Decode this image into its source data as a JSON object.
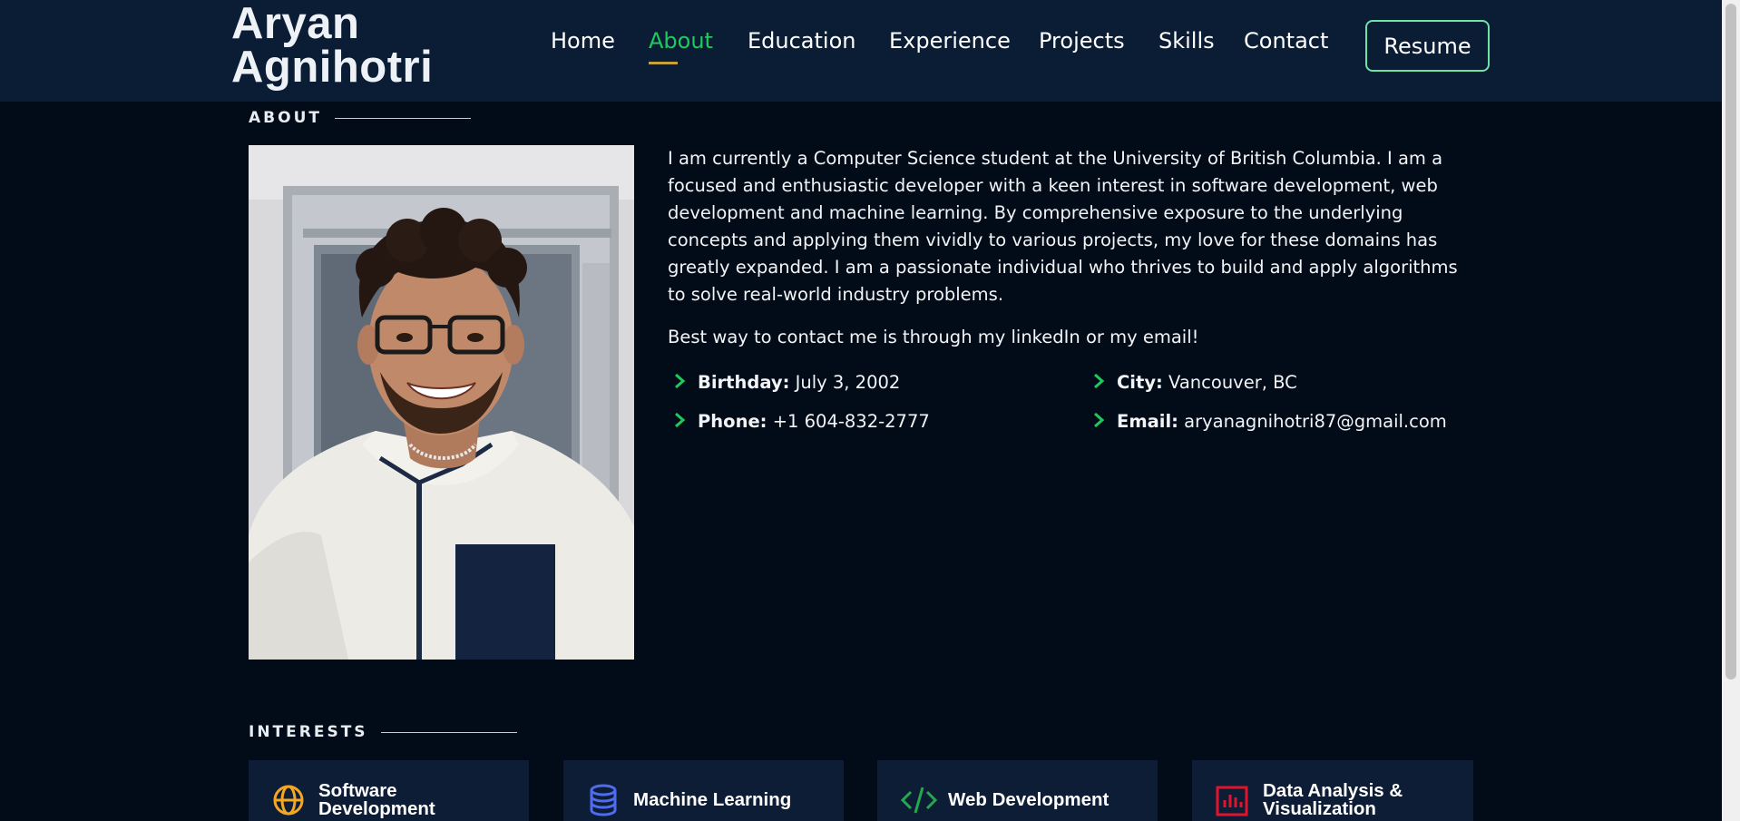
{
  "header": {
    "logo_line1": "Aryan",
    "logo_line2": "Agnihotri",
    "nav": [
      {
        "label": "Home",
        "active": false
      },
      {
        "label": "About",
        "active": true
      },
      {
        "label": "Education",
        "active": false
      },
      {
        "label": "Experience",
        "active": false
      },
      {
        "label": "Projects",
        "active": false
      },
      {
        "label": "Skills",
        "active": false
      },
      {
        "label": "Contact",
        "active": false
      }
    ],
    "resume_label": "Resume"
  },
  "about": {
    "section_title": "ABOUT",
    "bio": "I am currently a Computer Science student at the University of British Columbia. I am a focused and enthusiastic developer with a keen interest in software development, web development and machine learning. By comprehensive exposure to the underlying concepts and applying them vividly to various projects, my love for these domains has greatly expanded. I am a passionate individual who thrives to build and apply algorithms to solve real-world industry problems.",
    "contact_note": "Best way to contact me is through my linkedIn or my email!",
    "details": [
      {
        "label": "Birthday:",
        "value": "July 3, 2002"
      },
      {
        "label": "City:",
        "value": "Vancouver, BC"
      },
      {
        "label": "Phone:",
        "value": "+1 604-832-2777"
      },
      {
        "label": "Email:",
        "value": "aryanagnihotri87@gmail.com"
      }
    ]
  },
  "interests": {
    "section_title": "INTERESTS",
    "items": [
      {
        "line1": "Software",
        "line2": "Development",
        "icon": "globe-icon",
        "color": "#f5a623"
      },
      {
        "line1": "Machine Learning",
        "line2": "",
        "icon": "database-icon",
        "color": "#4f6bf0"
      },
      {
        "line1": "Web Development",
        "line2": "",
        "icon": "code-icon",
        "color": "#26a84f"
      },
      {
        "line1": "Data Analysis &",
        "line2": "Visualization",
        "icon": "bar-chart-icon",
        "color": "#e0152b"
      }
    ]
  },
  "colors": {
    "accent": "#1fc95d",
    "header_bg": "#0a1d35",
    "page_bg": "#020c18",
    "card_bg": "#0c1d35"
  }
}
